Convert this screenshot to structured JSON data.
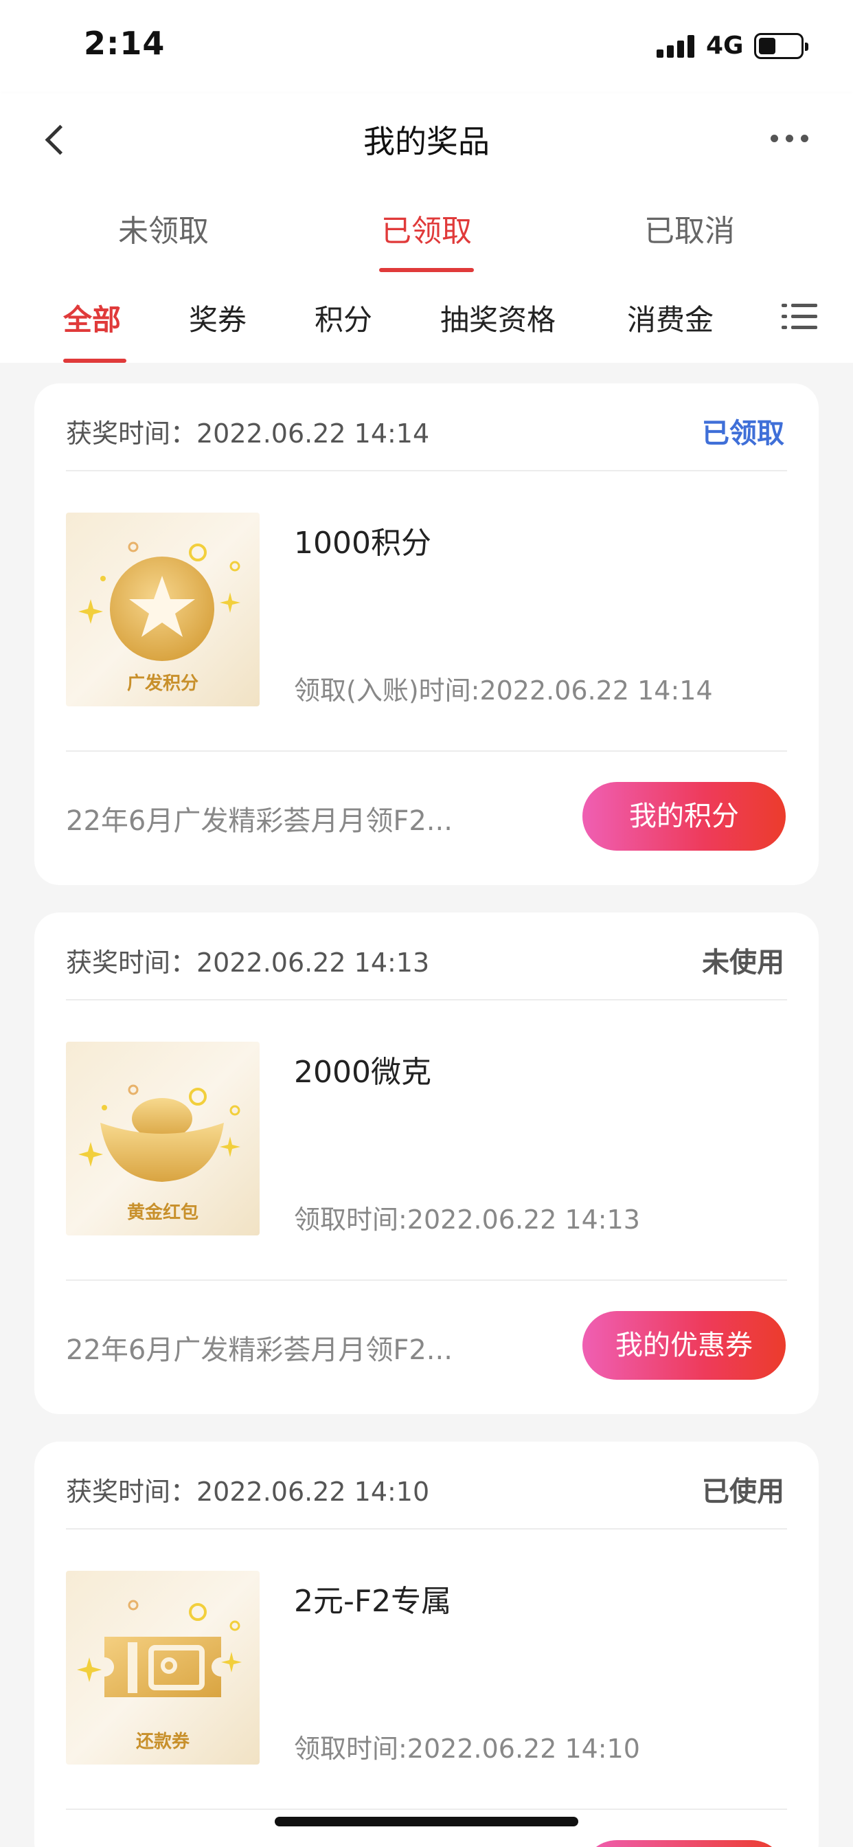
{
  "status_bar": {
    "time": "2:14",
    "network": "4G"
  },
  "nav": {
    "title": "我的奖品",
    "back_icon": "chevron-left-icon",
    "more_icon": "more-dots-icon"
  },
  "status_tabs": [
    {
      "label": "未领取",
      "active": false
    },
    {
      "label": "已领取",
      "active": true
    },
    {
      "label": "已取消",
      "active": false
    }
  ],
  "category_tabs": [
    {
      "label": "全部",
      "active": true
    },
    {
      "label": "奖券",
      "active": false
    },
    {
      "label": "积分",
      "active": false
    },
    {
      "label": "抽奖资格",
      "active": false
    },
    {
      "label": "消费金",
      "active": false
    }
  ],
  "cards": [
    {
      "award_time_label": "获奖时间：2022.06.22 14:14",
      "status": "已领取",
      "thumb_caption": "广发积分",
      "thumb_icon": "star-coin-icon",
      "prize_name": "1000积分",
      "received_time": "领取(入账)时间:2022.06.22 14:14",
      "activity": "22年6月广发精彩荟月月领F2...",
      "button": "我的积分"
    },
    {
      "award_time_label": "获奖时间：2022.06.22 14:13",
      "status": "未使用",
      "thumb_caption": "黄金红包",
      "thumb_icon": "gold-ingot-icon",
      "prize_name": "2000微克",
      "received_time": "领取时间:2022.06.22 14:13",
      "activity": "22年6月广发精彩荟月月领F2...",
      "button": "我的优惠券"
    },
    {
      "award_time_label": "获奖时间：2022.06.22 14:10",
      "status": "已使用",
      "thumb_caption": "还款券",
      "thumb_icon": "repayment-ticket-icon",
      "prize_name": "2元-F2专属",
      "received_time": "领取时间:2022.06.22 14:10",
      "activity": "",
      "button": ""
    }
  ],
  "colors": {
    "accent_red": "#e03a3a",
    "status_blue": "#3f6fd8",
    "button_gradient_start": "#ef5fb3",
    "button_gradient_end": "#ec3c2c"
  }
}
